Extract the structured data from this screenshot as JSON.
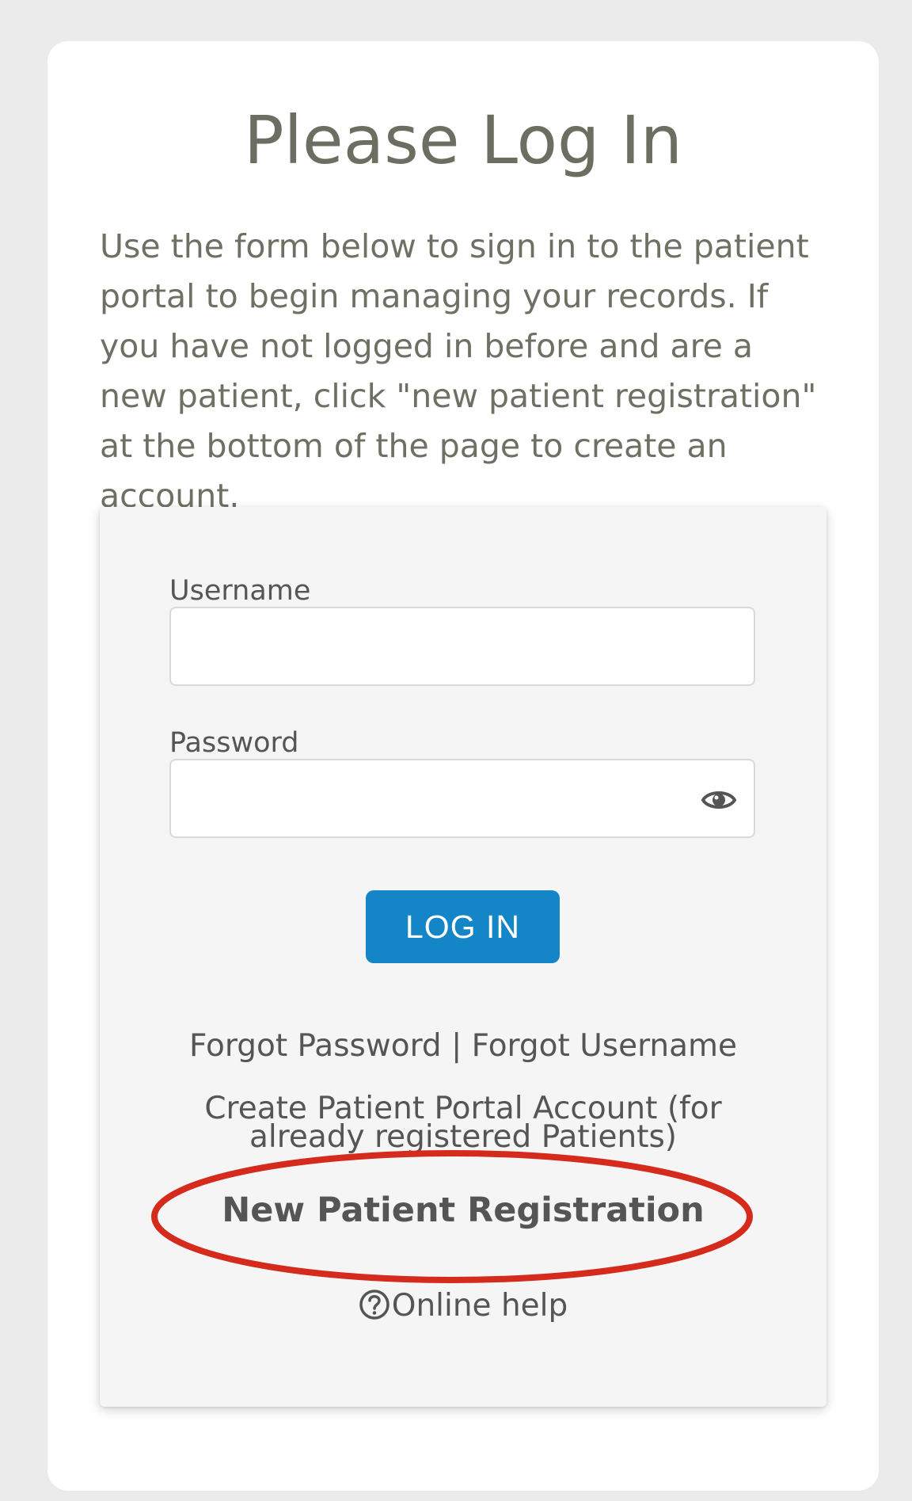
{
  "page": {
    "title": "Please Log In",
    "intro": "Use the form below to sign in to the patient portal to begin managing your records. If you have not logged in before and are a new patient, click \"new patient registration\" at the bottom of the page to create an account."
  },
  "form": {
    "username_label": "Username",
    "username_value": "",
    "password_label": "Password",
    "password_value": "",
    "password_toggle_icon": "eye-icon",
    "login_label": "LOG IN"
  },
  "links": {
    "forgot_password": "Forgot Password",
    "separator": "|",
    "forgot_username": "Forgot Username",
    "create_account": "Create Patient Portal Account (for already registered Patients)",
    "new_registration": "New Patient Registration",
    "help_icon": "question-circle-icon",
    "online_help": "Online help"
  },
  "colors": {
    "accent": "#1485c6",
    "highlight": "#d42b1d",
    "title_text": "#6b6e60"
  }
}
